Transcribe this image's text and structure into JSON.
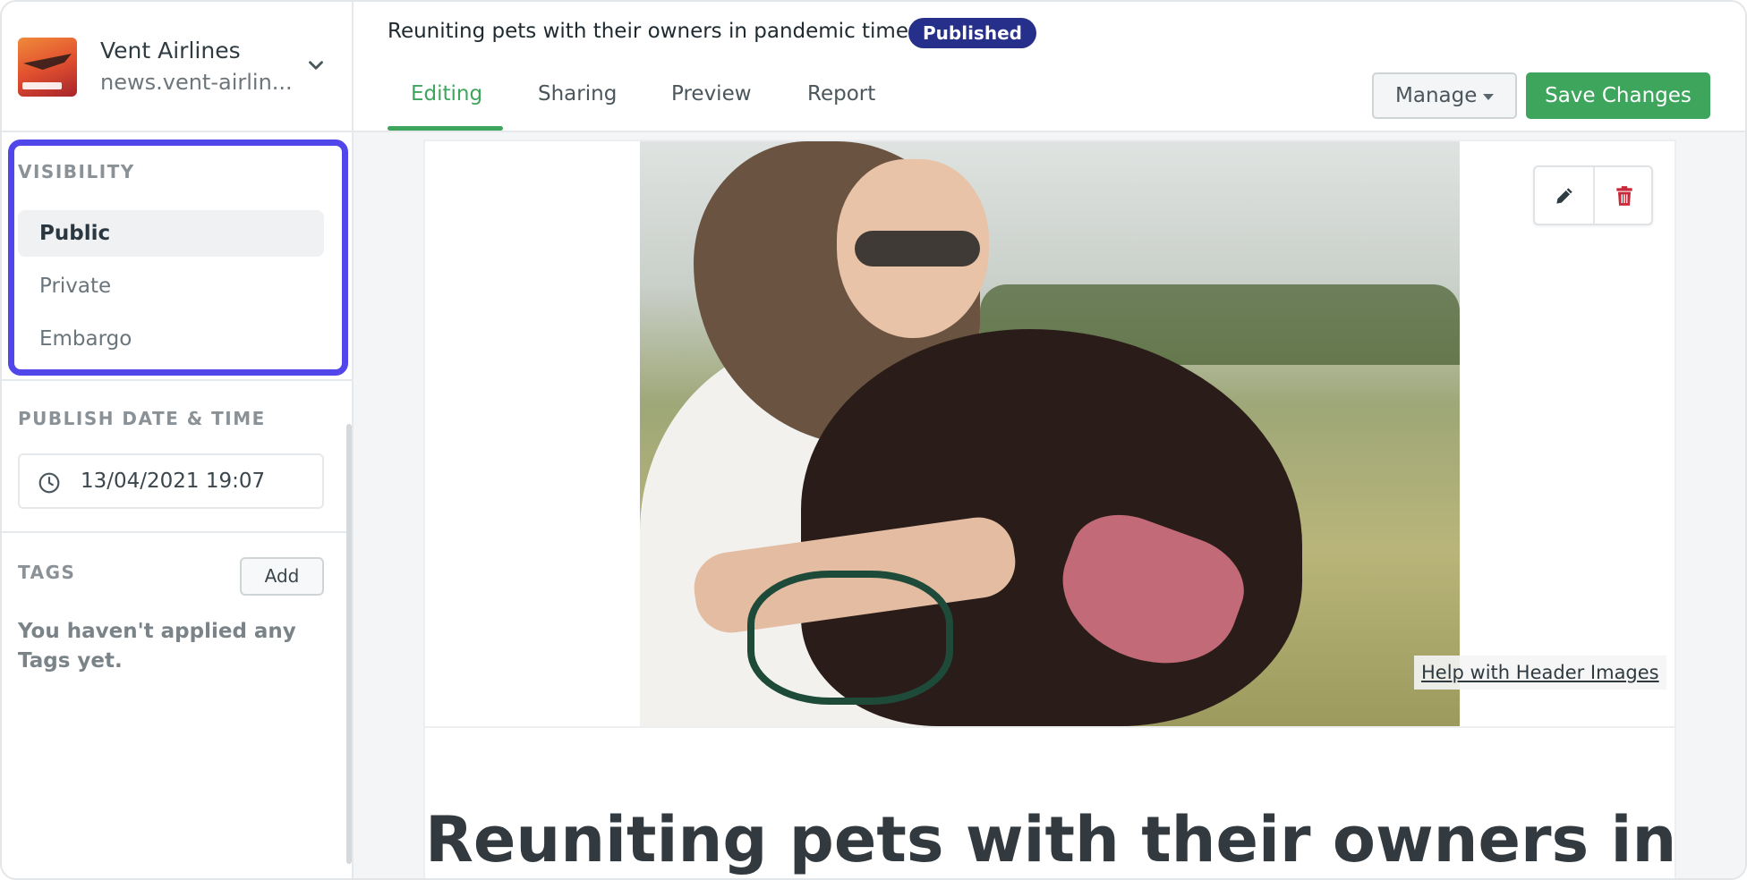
{
  "brand": {
    "name": "Vent Airlines",
    "url": "news.vent-airlin..."
  },
  "sidebar": {
    "visibility": {
      "title": "VISIBILITY",
      "options": [
        "Public",
        "Private",
        "Embargo"
      ],
      "selected": "Public"
    },
    "publish": {
      "title": "PUBLISH DATE & TIME",
      "value": "13/04/2021 19:07"
    },
    "tags": {
      "title": "TAGS",
      "add_label": "Add",
      "empty_text": "You haven't applied any Tags yet."
    }
  },
  "header": {
    "title": "Reuniting pets with their owners in pandemic times",
    "status": "Published",
    "tabs": [
      "Editing",
      "Sharing",
      "Preview",
      "Report"
    ],
    "active_tab": "Editing",
    "manage_label": "Manage",
    "save_label": "Save Changes"
  },
  "content": {
    "help_link": "Help with Header Images",
    "heading": "Reuniting pets with their owners in"
  },
  "colors": {
    "accent_green": "#3ea55c",
    "badge_navy": "#262f8a",
    "highlight_purple": "#5146ea",
    "delete_red": "#c8283a"
  }
}
